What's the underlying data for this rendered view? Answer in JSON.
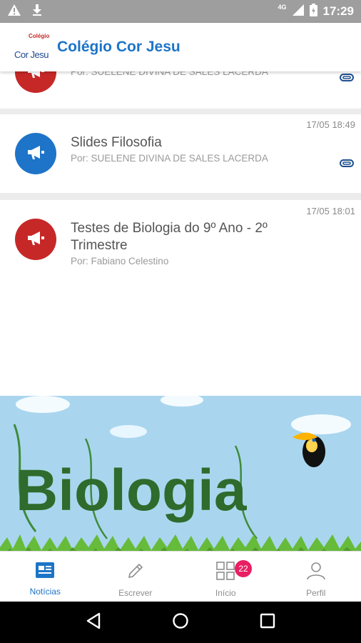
{
  "status_bar": {
    "time": "17:29",
    "network": "4G",
    "colors": {
      "background": "#9e9e9e"
    }
  },
  "app_bar": {
    "title": "Colégio Cor Jesu",
    "logo_text": "Cor Jesu",
    "logo_mark": "Colégio",
    "colors": {
      "title": "#1d74c7"
    }
  },
  "feed": {
    "posts": [
      {
        "title": "",
        "author": "Por: SUELENE DIVINA DE SALES LACERDA",
        "time": "",
        "icon": "megaphone-icon",
        "avatar_color": "#c62828",
        "has_attachment": true
      },
      {
        "title": "Slides Filosofia",
        "author": "Por: SUELENE DIVINA DE SALES LACERDA",
        "time": "17/05 18:49",
        "icon": "megaphone-icon",
        "avatar_color": "#1e74c8",
        "has_attachment": true
      },
      {
        "title": "Testes de Biologia do 9º Ano - 2º Trimestre",
        "author": "Por: Fabiano Celestino",
        "time": "17/05 18:01",
        "icon": "megaphone-icon",
        "avatar_color": "#c62828",
        "has_attachment": false
      }
    ],
    "image": {
      "text": "Biologia",
      "colors": {
        "sky": "#a9d6ee",
        "text": "#2e6b2c",
        "grass": "#66bb3a"
      }
    }
  },
  "bottom_nav": {
    "items": [
      {
        "label": "Notícias",
        "icon": "news-icon",
        "active": true
      },
      {
        "label": "Escrever",
        "icon": "pencil-icon",
        "active": false
      },
      {
        "label": "Início",
        "icon": "grid-icon",
        "active": false,
        "badge": "22"
      },
      {
        "label": "Perfil",
        "icon": "person-icon",
        "active": false
      }
    ]
  },
  "system_nav": {
    "icons": [
      "back-icon",
      "home-icon",
      "recents-icon"
    ]
  }
}
